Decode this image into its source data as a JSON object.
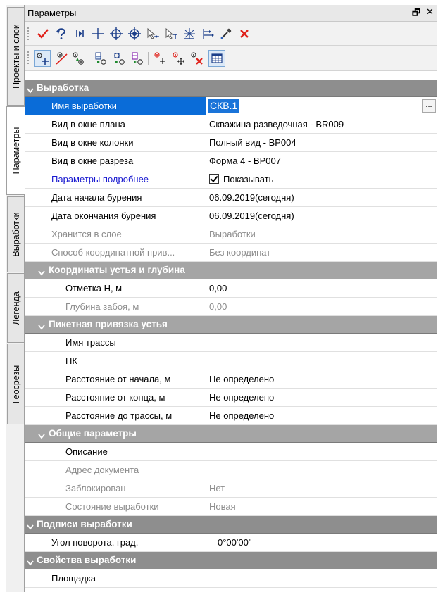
{
  "window": {
    "title": "Параметры",
    "float_glyph": "🗗",
    "close_glyph": "✕"
  },
  "side_tabs": [
    "Проекты и слои",
    "Параметры",
    "Выработки",
    "Легенда",
    "Геосрезы"
  ],
  "active_side_tab": "Параметры",
  "toolbar1": [
    "check-icon",
    "undo-pick-icon",
    "cursor-line-icon",
    "plus-icon",
    "circle-plus-icon",
    "diamond-plus-icon",
    "select-arrow-icon",
    "select-arrow-t-icon",
    "area-icon",
    "distance-icon",
    "eyedropper-icon",
    "delete-icon"
  ],
  "toolbar2": [
    "point-add-icon",
    "line-segment-icon",
    "point-minus-icon",
    "layer-add-icon",
    "layer-copy-icon",
    "layer-move-icon",
    "marker-add-icon",
    "marker-move-icon",
    "marker-delete-icon",
    "table-icon"
  ],
  "sections": {
    "vyrabotka": "Выработка",
    "coords": "Координаты устья и глубина",
    "picket": "Пикетная привязка устья",
    "general": "Общие параметры",
    "labels": "Подписи выработки",
    "props": "Свойства выработки"
  },
  "rows": {
    "name": {
      "label": "Имя выработки",
      "value": "СКВ.1",
      "button": "..."
    },
    "plan": {
      "label": "Вид в окне плана",
      "value": "Скважина разведочная - BR009"
    },
    "column": {
      "label": "Вид в окне колонки",
      "value": "Полный вид - BP004"
    },
    "section": {
      "label": "Вид в окне разреза",
      "value": "Форма 4 - BP007"
    },
    "more": {
      "label": "Параметры подробнее",
      "value": "Показывать"
    },
    "start": {
      "label": "Дата начала бурения",
      "value": "06.09.2019(сегодня)"
    },
    "end": {
      "label": "Дата окончания бурения",
      "value": "06.09.2019(сегодня)"
    },
    "layer": {
      "label": "Хранится в слое",
      "value": "Выработки"
    },
    "coordmode": {
      "label": "Способ координатной прив...",
      "value": "Без координат"
    },
    "elev": {
      "label": "Отметка Н, м",
      "value": "0,00"
    },
    "depth": {
      "label": "Глубина забоя, м",
      "value": "0,00"
    },
    "route": {
      "label": "Имя трассы",
      "value": ""
    },
    "pk": {
      "label": "ПК",
      "value": ""
    },
    "from_start": {
      "label": "Расстояние от начала, м",
      "value": "Не определено"
    },
    "from_end": {
      "label": "Расстояние от конца, м",
      "value": "Не определено"
    },
    "to_route": {
      "label": "Расстояние до трассы, м",
      "value": "Не определено"
    },
    "desc": {
      "label": "Описание",
      "value": ""
    },
    "docaddr": {
      "label": "Адрес документа",
      "value": ""
    },
    "locked": {
      "label": "Заблокирован",
      "value": "Нет"
    },
    "state": {
      "label": "Состояние выработки",
      "value": "Новая"
    },
    "angle": {
      "label": "Угол поворота, град.",
      "value": "0°00'00\""
    },
    "site": {
      "label": "Площадка",
      "value": ""
    }
  },
  "colors": {
    "selection": "#0a6cd8",
    "category": "#8e8e8e",
    "subcategory": "#a5a5a5",
    "link": "#1a1ad0",
    "disabled": "#8c8c8c",
    "red_icon": "#e0211a"
  }
}
